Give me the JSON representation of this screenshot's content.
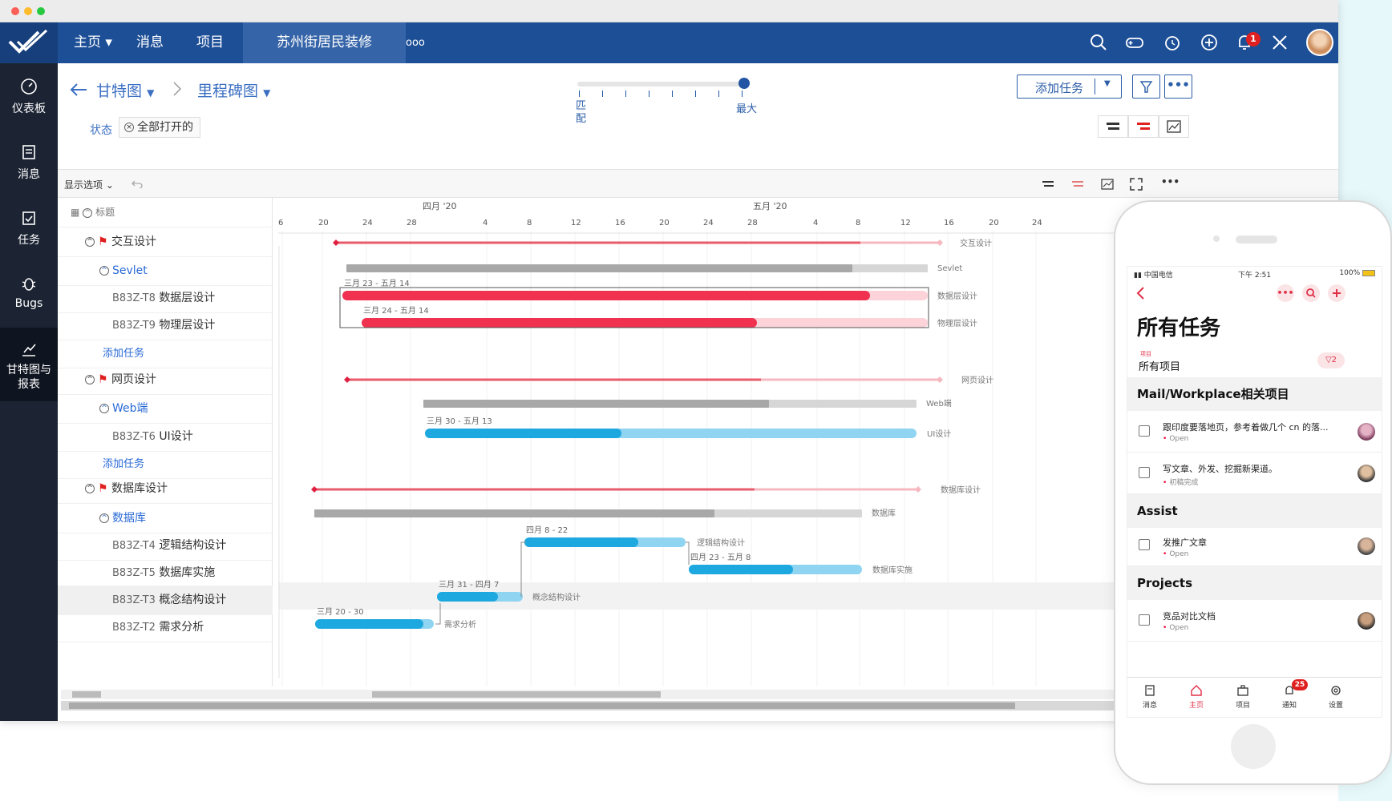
{
  "nav": {
    "home": "主页",
    "messages": "消息",
    "projects": "项目",
    "current_project": "苏州街居民装修",
    "more": "ooo",
    "notif_count": "1"
  },
  "sidebar": {
    "items": [
      {
        "label": "仪表板"
      },
      {
        "label": "消息"
      },
      {
        "label": "任务"
      },
      {
        "label": "Bugs"
      },
      {
        "label": "甘特图与报表"
      }
    ]
  },
  "toolbar": {
    "crumb1": "甘特图",
    "crumb2": "里程碑图",
    "zoom_min": "匹配",
    "zoom_max": "最大",
    "add_task": "添加任务",
    "status_label": "状态",
    "status_filter": "全部打开的",
    "display_options": "显示选项",
    "title_col": "标题"
  },
  "tasks": [
    {
      "kind": "group",
      "name": "交互设计"
    },
    {
      "kind": "sub",
      "name": "Sevlet"
    },
    {
      "kind": "task",
      "id": "B83Z-T8",
      "name": "数据层设计"
    },
    {
      "kind": "task",
      "id": "B83Z-T9",
      "name": "物理层设计"
    },
    {
      "kind": "add",
      "name": "添加任务"
    },
    {
      "kind": "group",
      "name": "网页设计"
    },
    {
      "kind": "sub",
      "name": "Web端"
    },
    {
      "kind": "task",
      "id": "B83Z-T6",
      "name": "UI设计"
    },
    {
      "kind": "add",
      "name": "添加任务"
    },
    {
      "kind": "group",
      "name": "数据库设计"
    },
    {
      "kind": "sub",
      "name": "数据库"
    },
    {
      "kind": "task",
      "id": "B83Z-T4",
      "name": "逻辑结构设计"
    },
    {
      "kind": "task",
      "id": "B83Z-T5",
      "name": "数据库实施"
    },
    {
      "kind": "task",
      "id": "B83Z-T3",
      "name": "概念结构设计"
    },
    {
      "kind": "task",
      "id": "B83Z-T2",
      "name": "需求分析"
    }
  ],
  "timeline": {
    "months": [
      "四月 '20",
      "五月 '20"
    ],
    "days": [
      "6",
      "20",
      "24",
      "28",
      "4",
      "8",
      "12",
      "16",
      "20",
      "24",
      "28",
      "4",
      "8",
      "12",
      "16",
      "20",
      "24"
    ],
    "bars": [
      {
        "label": "交互设计"
      },
      {
        "label": "Sevlet"
      },
      {
        "label": "数据层设计",
        "range": "三月 23 - 五月 14"
      },
      {
        "label": "物理层设计",
        "range": "三月 24 - 五月 14"
      },
      {
        "label": "网页设计"
      },
      {
        "label": "Web端"
      },
      {
        "label": "UI设计",
        "range": "三月 30 - 五月 13"
      },
      {
        "label": "数据库设计"
      },
      {
        "label": "数据库"
      },
      {
        "label": "逻辑结构设计",
        "range": "四月 8 - 22"
      },
      {
        "label": "数据库实施",
        "range": "四月 23 - 五月 8"
      },
      {
        "label": "概念结构设计",
        "range": "三月 31 - 四月 7"
      },
      {
        "label": "需求分析",
        "range": "三月 20 - 30"
      }
    ]
  },
  "phone": {
    "carrier": "中国电信",
    "time": "下午 2:51",
    "battery": "100%",
    "page_title": "所有任务",
    "project_label": "项目",
    "project_value": "所有项目",
    "filter_count": "2",
    "sections": [
      {
        "title": "Mail/Workplace相关项目",
        "tasks": [
          {
            "title": "跟印度要落地页，参考着做几个 cn 的落...",
            "status": "Open"
          },
          {
            "title": "写文章、外发、挖掘新渠道。",
            "status": "初稿完成"
          }
        ]
      },
      {
        "title": "Assist",
        "tasks": [
          {
            "title": "发推广文章",
            "status": "Open"
          }
        ]
      },
      {
        "title": "Projects",
        "tasks": [
          {
            "title": "竞品对比文档",
            "status": "Open"
          }
        ]
      }
    ],
    "tabs": [
      "消息",
      "主页",
      "项目",
      "通知",
      "设置"
    ],
    "notif_badge": "25"
  },
  "colors": {
    "nav": "#1d4f97",
    "red": "#f0314f",
    "blue": "#1ea8e0",
    "gray": "#aaaaaa"
  }
}
